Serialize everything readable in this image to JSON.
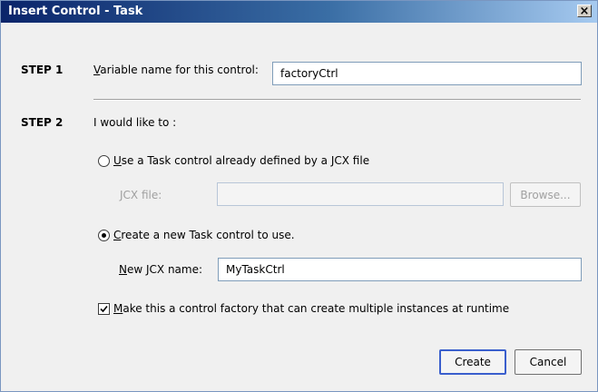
{
  "window": {
    "title": "Insert Control - Task",
    "close_glyph": "×"
  },
  "step1": {
    "label": "STEP 1",
    "var_label_first": "V",
    "var_label_rest": "ariable name for this control:",
    "var_value": "factoryCtrl"
  },
  "step2": {
    "label": "STEP 2",
    "prompt": "I would like to :",
    "option1_first": "U",
    "option1_rest": "se a Task control already defined by a JCX file",
    "jcx_file_label": "JCX file:",
    "jcx_file_value": "",
    "browse_label": "Browse...",
    "option2_first": "C",
    "option2_rest": "reate a new Task control to use.",
    "new_jcx_first": "N",
    "new_jcx_rest": "ew JCX name:",
    "new_jcx_value": "MyTaskCtrl",
    "factory_first": "M",
    "factory_rest": "ake this a control factory that can create multiple instances at runtime",
    "factory_checked": true,
    "selected_option": "create-new"
  },
  "buttons": {
    "create_label": "Create",
    "cancel_label": "Cancel"
  },
  "colors": {
    "titlebar_start": "#0a246a",
    "titlebar_end": "#a6caf0",
    "default_button_border": "#3a5fcd"
  },
  "icons": {
    "close": "close-icon",
    "radio_selected": "radio-selected-icon",
    "checkbox_checked": "checkmark-icon"
  }
}
